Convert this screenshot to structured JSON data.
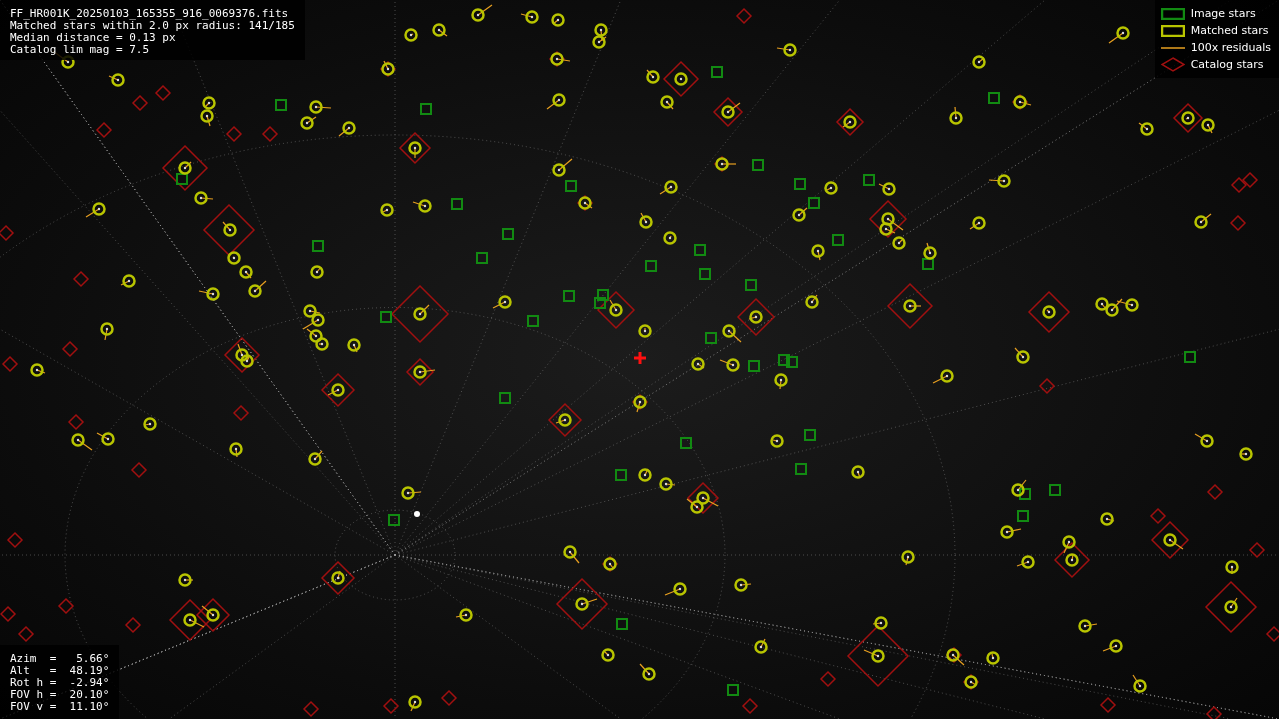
{
  "header_info": [
    "FF_HR001K_20250103_165355_916_0069376.fits",
    "Matched stars within 2.0 px radius: 141/185",
    "Median distance = 0.13 px",
    "Catalog lim mag = 7.5"
  ],
  "legend": [
    {
      "kind": "image",
      "label": "Image stars"
    },
    {
      "kind": "matched",
      "label": "Matched stars"
    },
    {
      "kind": "residual",
      "label": "100x residuals"
    },
    {
      "kind": "catalog",
      "label": "Catalog stars"
    }
  ],
  "pointing_info": [
    "Azim  =   5.66°",
    "Alt   =  48.19°",
    "Rot h =  -2.94°",
    "FOV h =  20.10°",
    "FOV v =  11.10°"
  ]
}
